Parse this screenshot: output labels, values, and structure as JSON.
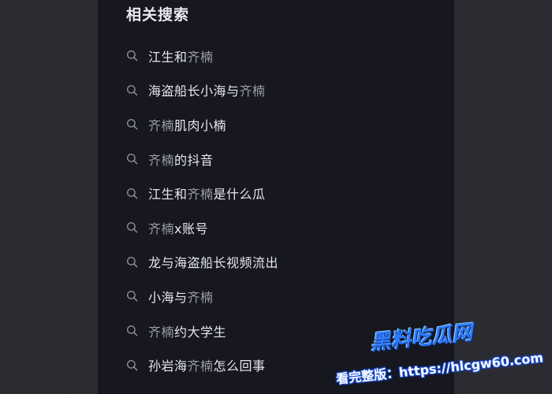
{
  "related_search": {
    "title": "相关搜索",
    "items": [
      {
        "before": "江生和",
        "hl": "齐楠",
        "after": ""
      },
      {
        "before": "海盗船长小海与",
        "hl": "齐楠",
        "after": ""
      },
      {
        "before": "",
        "hl": "齐楠",
        "after": "肌肉小楠"
      },
      {
        "before": "",
        "hl": "齐楠",
        "after": "的抖音"
      },
      {
        "before": "江生和",
        "hl": "齐楠",
        "after": "是什么瓜"
      },
      {
        "before": "",
        "hl": "齐楠",
        "after": "x账号"
      },
      {
        "before": "龙与海盗船长视频流出",
        "hl": "",
        "after": ""
      },
      {
        "before": "小海与",
        "hl": "齐楠",
        "after": ""
      },
      {
        "before": "",
        "hl": "齐楠",
        "after": "约大学生"
      },
      {
        "before": "孙岩海",
        "hl": "齐楠",
        "after": "怎么回事"
      }
    ]
  },
  "watermark": {
    "logo": "黑料吃瓜网",
    "url_text": "看完整版：https://hlcgw60.com"
  },
  "colors": {
    "background": "#2a2b31",
    "panel": "#16171f",
    "text": "#e6e7ec",
    "highlight_text": "#9b9ca6",
    "watermark_blue": "#2f7bff"
  },
  "icons": {
    "search": "search-icon"
  }
}
